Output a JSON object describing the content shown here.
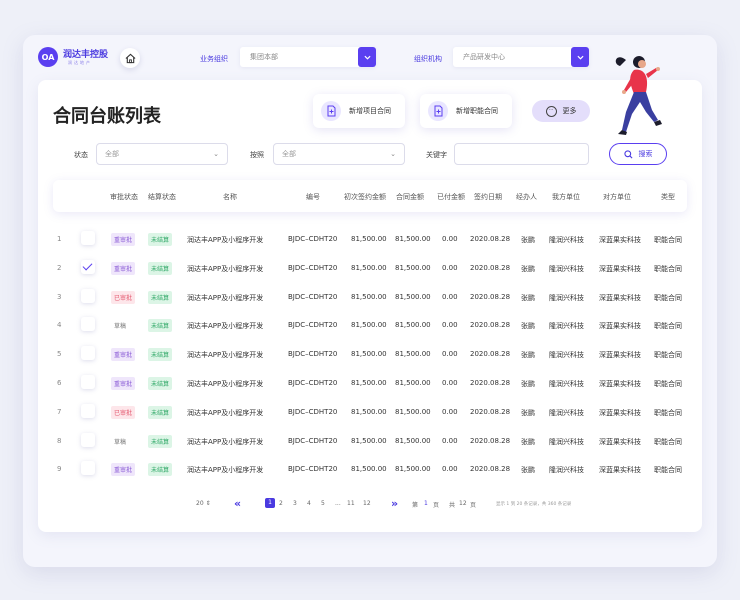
{
  "brand": {
    "badge": "OA",
    "name": "润达丰控股",
    "sub": "润达地产"
  },
  "topbar": {
    "org_label": "业务组织",
    "org_value": "集团本部",
    "dept_label": "组织机构",
    "dept_value": "产品研发中心"
  },
  "page": {
    "title": "合同台账列表"
  },
  "actions": {
    "new_project": "新增项目合同",
    "new_function": "新增职能合同",
    "more": "更多"
  },
  "filters": {
    "status_label": "状态",
    "status_value": "全部",
    "by_label": "按照",
    "by_value": "全部",
    "keyword_label": "关键字",
    "keyword_value": "",
    "search_label": "搜索"
  },
  "table": {
    "headers": [
      "审批状态",
      "结算状态",
      "名称",
      "编号",
      "初次签约金额",
      "合同金额",
      "已付金额",
      "签约日期",
      "经办人",
      "我方单位",
      "对方单位",
      "类型"
    ],
    "rows": [
      {
        "no": "1",
        "checked": false,
        "approval": "重审批",
        "approval_kind": "review",
        "settle": "未结算",
        "name": "润达丰APP及小程序开发",
        "code": "BJDC–CDHT20",
        "initial": "81,500.00",
        "amount": "81,500.00",
        "paid": "0.00",
        "date": "2020.08.28",
        "handler": "张鹏",
        "ours": "隆润兴科技",
        "theirs": "深蓝果实科技",
        "type": "职能合同"
      },
      {
        "no": "2",
        "checked": true,
        "approval": "重审批",
        "approval_kind": "review",
        "settle": "未结算",
        "name": "润达丰APP及小程序开发",
        "code": "BJDC–CDHT20",
        "initial": "81,500.00",
        "amount": "81,500.00",
        "paid": "0.00",
        "date": "2020.08.28",
        "handler": "张鹏",
        "ours": "隆润兴科技",
        "theirs": "深蓝果实科技",
        "type": "职能合同"
      },
      {
        "no": "3",
        "checked": false,
        "approval": "已审批",
        "approval_kind": "approved",
        "settle": "未结算",
        "name": "润达丰APP及小程序开发",
        "code": "BJDC–CDHT20",
        "initial": "81,500.00",
        "amount": "81,500.00",
        "paid": "0.00",
        "date": "2020.08.28",
        "handler": "张鹏",
        "ours": "隆润兴科技",
        "theirs": "深蓝果实科技",
        "type": "职能合同"
      },
      {
        "no": "4",
        "checked": false,
        "approval": "草稿",
        "approval_kind": "draft",
        "settle": "未结算",
        "name": "润达丰APP及小程序开发",
        "code": "BJDC–CDHT20",
        "initial": "81,500.00",
        "amount": "81,500.00",
        "paid": "0.00",
        "date": "2020.08.28",
        "handler": "张鹏",
        "ours": "隆润兴科技",
        "theirs": "深蓝果实科技",
        "type": "职能合同"
      },
      {
        "no": "5",
        "checked": false,
        "approval": "重审批",
        "approval_kind": "review",
        "settle": "未结算",
        "name": "润达丰APP及小程序开发",
        "code": "BJDC–CDHT20",
        "initial": "81,500.00",
        "amount": "81,500.00",
        "paid": "0.00",
        "date": "2020.08.28",
        "handler": "张鹏",
        "ours": "隆润兴科技",
        "theirs": "深蓝果实科技",
        "type": "职能合同"
      },
      {
        "no": "6",
        "checked": false,
        "approval": "重审批",
        "approval_kind": "review",
        "settle": "未结算",
        "name": "润达丰APP及小程序开发",
        "code": "BJDC–CDHT20",
        "initial": "81,500.00",
        "amount": "81,500.00",
        "paid": "0.00",
        "date": "2020.08.28",
        "handler": "张鹏",
        "ours": "隆润兴科技",
        "theirs": "深蓝果实科技",
        "type": "职能合同"
      },
      {
        "no": "7",
        "checked": false,
        "approval": "已审批",
        "approval_kind": "approved",
        "settle": "未结算",
        "name": "润达丰APP及小程序开发",
        "code": "BJDC–CDHT20",
        "initial": "81,500.00",
        "amount": "81,500.00",
        "paid": "0.00",
        "date": "2020.08.28",
        "handler": "张鹏",
        "ours": "隆润兴科技",
        "theirs": "深蓝果实科技",
        "type": "职能合同"
      },
      {
        "no": "8",
        "checked": false,
        "approval": "草稿",
        "approval_kind": "draft",
        "settle": "未结算",
        "name": "润达丰APP及小程序开发",
        "code": "BJDC–CDHT20",
        "initial": "81,500.00",
        "amount": "81,500.00",
        "paid": "0.00",
        "date": "2020.08.28",
        "handler": "张鹏",
        "ours": "隆润兴科技",
        "theirs": "深蓝果实科技",
        "type": "职能合同"
      },
      {
        "no": "9",
        "checked": false,
        "approval": "重审批",
        "approval_kind": "review",
        "settle": "未结算",
        "name": "润达丰APP及小程序开发",
        "code": "BJDC–CDHT20",
        "initial": "81,500.00",
        "amount": "81,500.00",
        "paid": "0.00",
        "date": "2020.08.28",
        "handler": "张鹏",
        "ours": "隆润兴科技",
        "theirs": "深蓝果实科技",
        "type": "职能合同"
      }
    ]
  },
  "pagination": {
    "page_size": "20",
    "pages": [
      "1",
      "2",
      "3",
      "4",
      "5",
      "...",
      "11",
      "12"
    ],
    "current": "1",
    "prefix": "第",
    "current_page": "1",
    "page_word": "页",
    "total_prefix": "共",
    "total_pages": "12",
    "total_word": "页",
    "summary": "显示 1 到 20 条记录，共 360 条记录"
  },
  "colors": {
    "accent": "#5a3ff0",
    "review_bg": "#efe6fb",
    "review_fg": "#8a5bd6",
    "approved_bg": "#fde6ea",
    "approved_fg": "#e45a70",
    "settle_bg": "#dcf5e6",
    "settle_fg": "#2ea866"
  }
}
